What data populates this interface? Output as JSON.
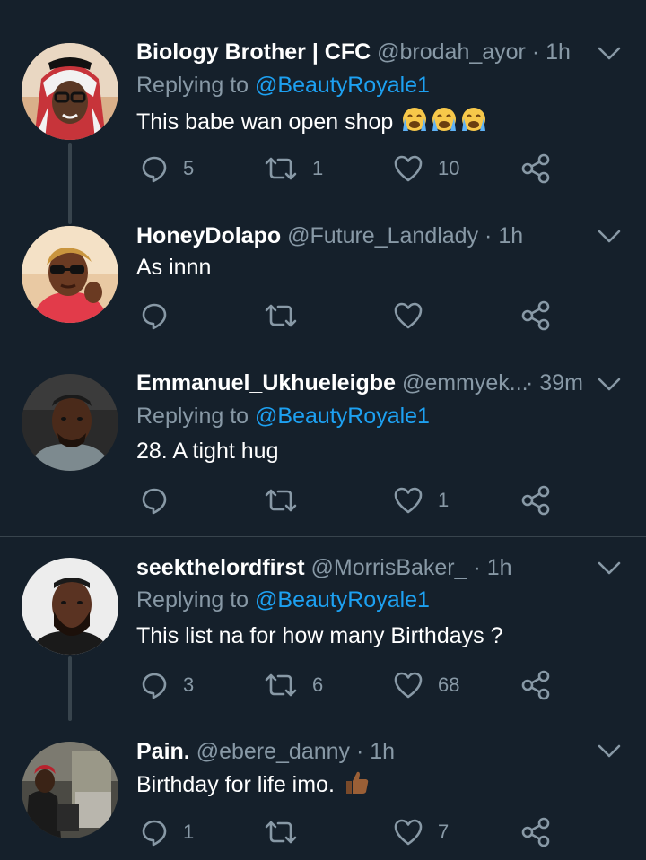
{
  "colors": {
    "background": "#15202b",
    "separator": "#38444d",
    "secondary_text": "#8899a6",
    "link": "#1da1f2",
    "primary_text": "#ffffff"
  },
  "icons": {
    "reply": "speech-bubble-icon",
    "retweet": "retweet-arrows-icon",
    "like": "heart-outline-icon",
    "share": "share-nodes-icon",
    "more": "chevron-down-icon"
  },
  "tweets": [
    {
      "name": "Biology Brother | CFC",
      "handle": "@brodah_ayor",
      "dot": "·",
      "time": "1h",
      "replying_prefix": "Replying to",
      "replying_to": "@BeautyRoyale1",
      "text": "This babe wan open shop",
      "emoji": "crying-face-emoji x3",
      "replies": "5",
      "retweets": "1",
      "likes": "10"
    },
    {
      "name": "HoneyDolapo",
      "handle": "@Future_Landlady",
      "dot": "·",
      "time": "1h",
      "text": "As innn",
      "replies": "",
      "retweets": "",
      "likes": ""
    },
    {
      "name": "Emmanuel_Ukhueleigbe",
      "handle": "@emmyek...",
      "dot": "·",
      "time": "39m",
      "replying_prefix": "Replying to",
      "replying_to": "@BeautyRoyale1",
      "text": "28. A tight hug",
      "replies": "",
      "retweets": "",
      "likes": "1"
    },
    {
      "name": "seekthelordfirst",
      "handle": "@MorrisBaker_",
      "dot": "·",
      "time": "1h",
      "replying_prefix": "Replying to",
      "replying_to": "@BeautyRoyale1",
      "text": "This list na for how many Birthdays ?",
      "replies": "3",
      "retweets": "6",
      "likes": "68"
    },
    {
      "name": "Pain.",
      "handle": "@ebere_danny",
      "dot": "·",
      "time": "1h",
      "text": "Birthday for life imo.",
      "emoji": "thumbs-up-emoji",
      "replies": "1",
      "retweets": "",
      "likes": "7"
    }
  ]
}
